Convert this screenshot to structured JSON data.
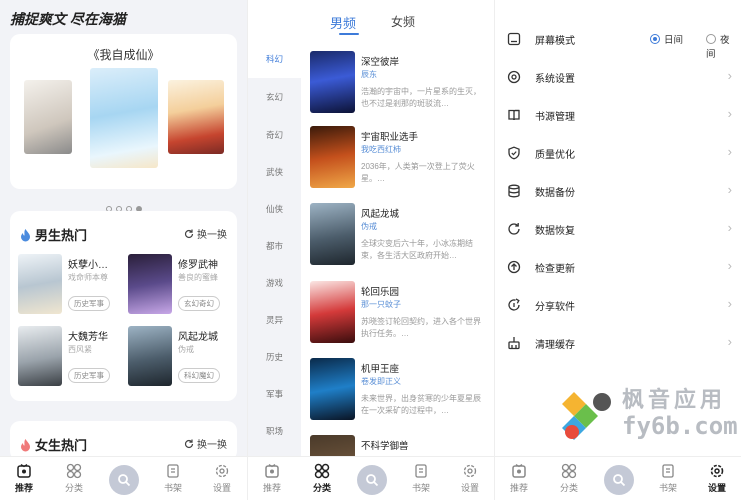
{
  "left_panel": {
    "slogan": "捕捉爽文 尽在海猫",
    "featured_title": "《我自成仙》",
    "male_section": {
      "title": "男生热门",
      "swap": "换一换",
      "books": [
        {
          "title": "妖孽小…",
          "author": "戏命师本尊",
          "genre": "历史军事"
        },
        {
          "title": "修罗武神",
          "author": "善良的蜜蜂",
          "genre": "玄幻奇幻"
        },
        {
          "title": "大魏芳华",
          "author": "西风紧",
          "genre": "历史军事"
        },
        {
          "title": "风起龙城",
          "author": "伪戒",
          "genre": "科幻魔幻"
        }
      ]
    },
    "female_section": {
      "title": "女生热门",
      "swap": "换一换"
    }
  },
  "middle_panel": {
    "tabs": [
      "男频",
      "女频"
    ],
    "categories": [
      "科幻",
      "玄幻",
      "奇幻",
      "武侠",
      "仙侠",
      "都市",
      "游戏",
      "灵异",
      "历史",
      "军事",
      "职场"
    ],
    "books": [
      {
        "title": "深空彼岸",
        "author": "辰东",
        "desc": "浩瀚的宇宙中，一片星系的生灭，也不过是剎那的斑驳流…"
      },
      {
        "title": "宇宙职业选手",
        "author": "我吃西红柿",
        "desc": "2036年，人类第一次登上了荧火星。…"
      },
      {
        "title": "风起龙城",
        "author": "伪戒",
        "desc": "全球灾变后六十年，小冰冻期结束，各生活大区政府开始…"
      },
      {
        "title": "轮回乐园",
        "author": "那一只蚊子",
        "desc": "苏晓签订轮回契约，进入各个世界执行任务。…"
      },
      {
        "title": "机甲王座",
        "author": "卷发即正义",
        "desc": "未来世界，出身贫寒的少年夏星辰在一次采矿的过程中，…"
      },
      {
        "title": "不科学御兽",
        "author": "",
        "desc": ""
      }
    ]
  },
  "right_panel": {
    "screen_mode": {
      "label": "屏幕模式",
      "options": [
        "日间",
        "夜间"
      ],
      "selected": "日间"
    },
    "items": [
      "系统设置",
      "书源管理",
      "质量优化",
      "数据备份",
      "数据恢复",
      "检查更新",
      "分享软件",
      "清理缓存"
    ]
  },
  "tabbar": {
    "items": [
      "推荐",
      "分类",
      "书架",
      "设置"
    ]
  },
  "watermark": {
    "name": "枫音应用",
    "domain": "fy6b.com"
  },
  "colors": {
    "accent": "#3d7bd9",
    "bg": "#f2f3f7"
  }
}
